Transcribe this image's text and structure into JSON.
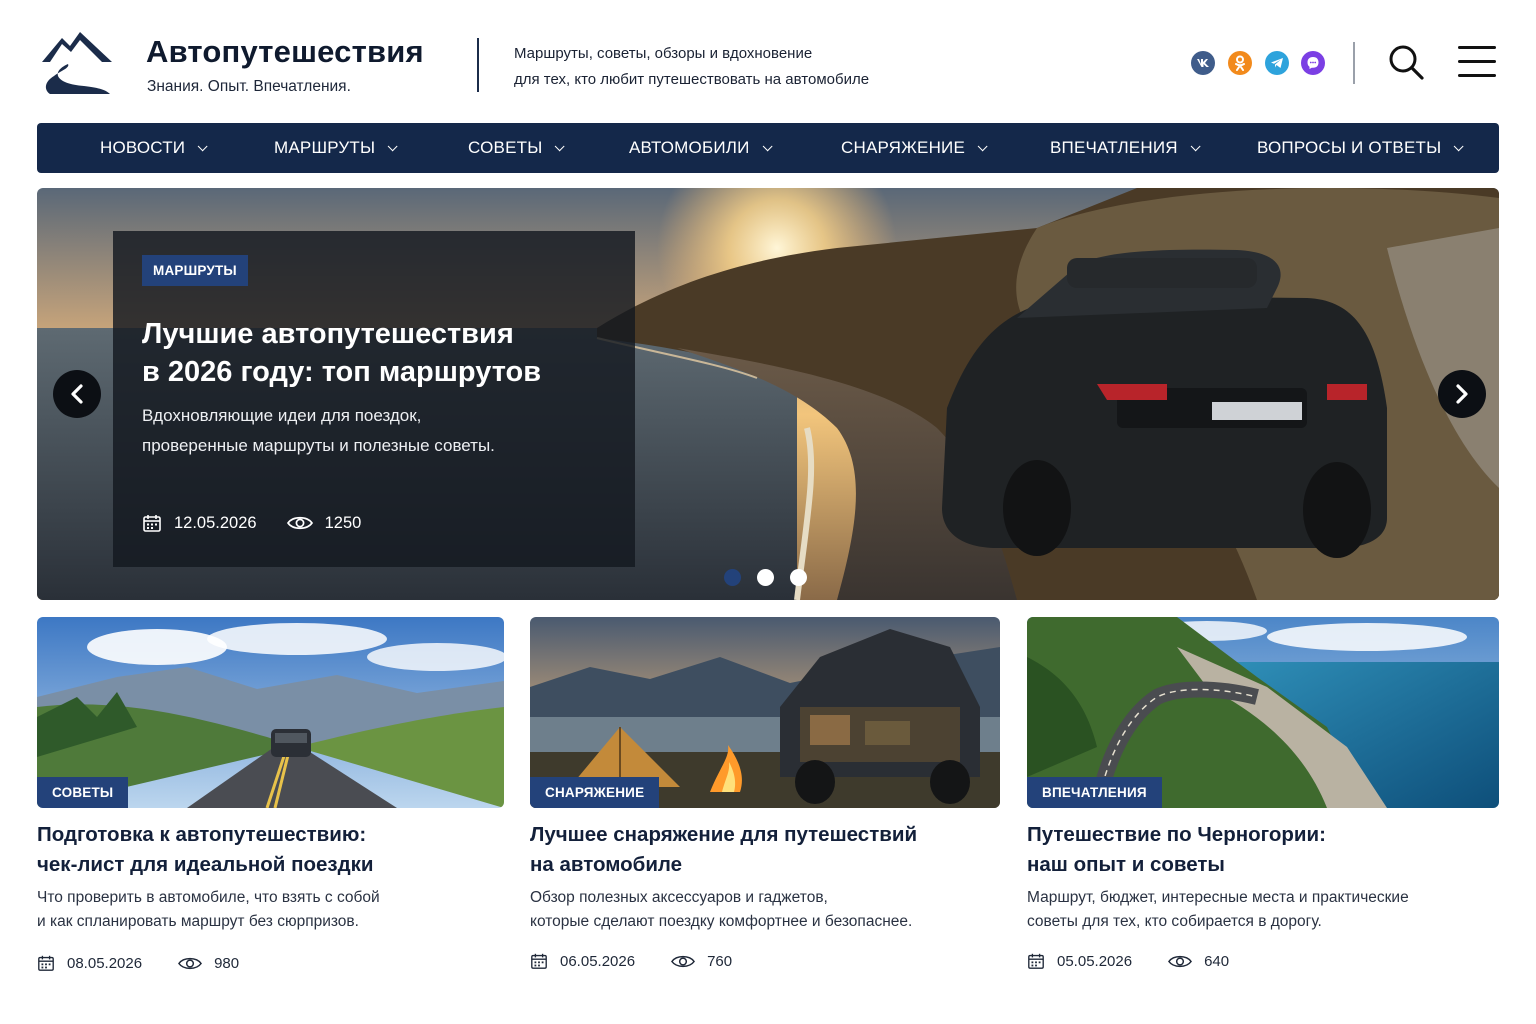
{
  "site": {
    "title": "Автопутешествия",
    "tagline": "Знания. Опыт. Впечатления.",
    "description_line1": "Маршруты, советы, обзоры и вдохновение",
    "description_line2": "для тех, кто любит путешествовать на автомобиле"
  },
  "social": [
    {
      "name": "vk",
      "icon": "vk-icon",
      "color": "#3f5c8a"
    },
    {
      "name": "ok",
      "icon": "ok-icon",
      "color": "#f28a1c"
    },
    {
      "name": "telegram",
      "icon": "telegram-icon",
      "color": "#2ea3dc"
    },
    {
      "name": "viber",
      "icon": "viber-icon",
      "color": "#7b3fe4"
    }
  ],
  "nav": {
    "items": [
      {
        "label": "НОВОСТИ"
      },
      {
        "label": "МАРШРУТЫ"
      },
      {
        "label": "СОВЕТЫ"
      },
      {
        "label": "АВТОМОБИЛИ"
      },
      {
        "label": "СНАРЯЖЕНИЕ"
      },
      {
        "label": "ВПЕЧАТЛЕНИЯ"
      },
      {
        "label": "ВОПРОСЫ И ОТВЕТЫ"
      }
    ]
  },
  "hero": {
    "category": "МАРШРУТЫ",
    "title_line1": "Лучшие автопутешествия",
    "title_line2": "в 2026 году: топ маршрутов",
    "desc_line1": "Вдохновляющие идеи для поездок,",
    "desc_line2": "проверенные маршруты и полезные советы.",
    "date": "12.05.2026",
    "views": "1250",
    "slides_total": 3,
    "active_slide": 1
  },
  "cards": [
    {
      "category": "СОВЕТЫ",
      "title_line1": "Подготовка к автопутешествию:",
      "title_line2": "чек-лист для идеальной поездки",
      "desc_line1": "Что проверить в автомобиле, что взять с собой",
      "desc_line2": "и как спланировать маршрут без сюрпризов.",
      "date": "08.05.2026",
      "views": "980"
    },
    {
      "category": "СНАРЯЖЕНИЕ",
      "title_line1": "Лучшее снаряжение для путешествий",
      "title_line2": "на автомобиле",
      "desc_line1": "Обзор полезных аксессуаров и гаджетов,",
      "desc_line2": "которые сделают поездку комфортнее и безопаснее.",
      "date": "06.05.2026",
      "views": "760"
    },
    {
      "category": "ВПЕЧАТЛЕНИЯ",
      "title_line1": "Путешествие по Черногории:",
      "title_line2": "наш опыт и советы",
      "desc_line1": "Маршрут, бюджет, интересные места и практические",
      "desc_line2": "советы для тех, кто собирается в дорогу.",
      "date": "05.05.2026",
      "views": "640"
    }
  ],
  "colors": {
    "navy": "#14284a",
    "badge": "#23427a",
    "text": "#13203a"
  }
}
